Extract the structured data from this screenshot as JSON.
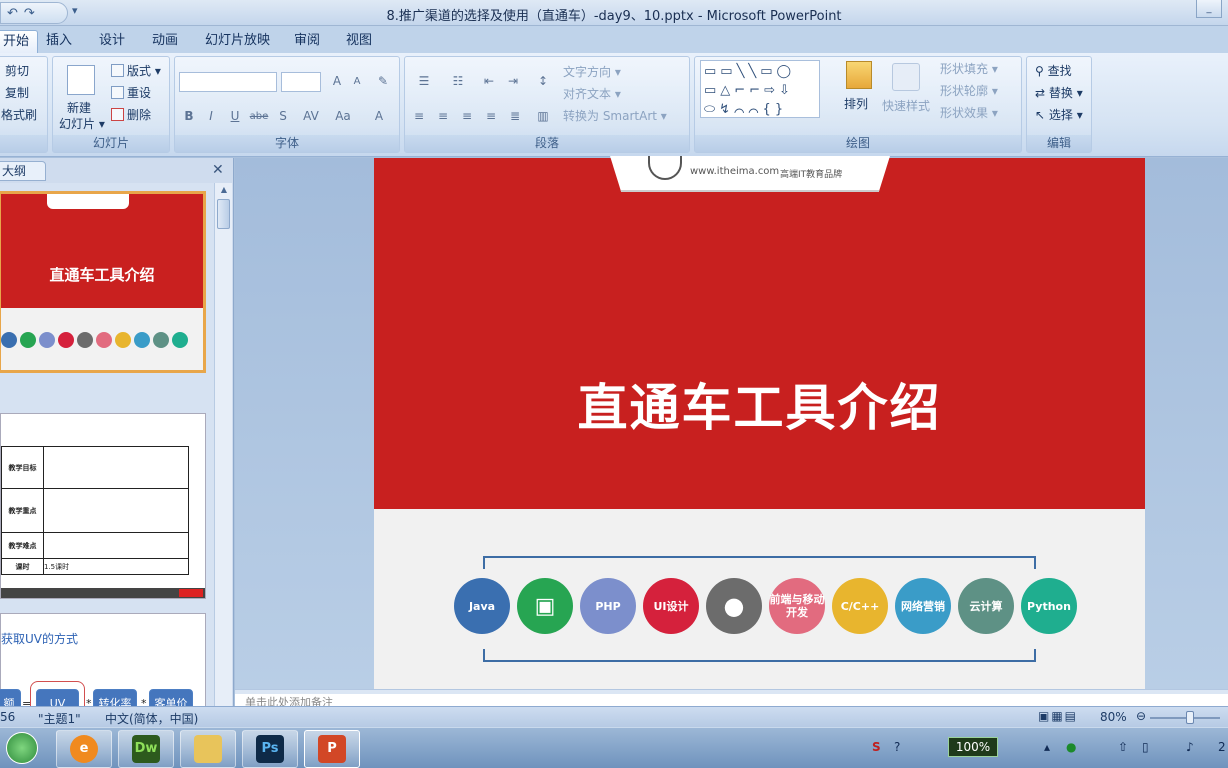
{
  "window": {
    "title": "8.推广渠道的选择及使用（直通车）-day9、10.pptx - Microsoft PowerPoint",
    "qat_more": "▾"
  },
  "tabs": [
    "开始",
    "插入",
    "设计",
    "动画",
    "幻灯片放映",
    "审阅",
    "视图"
  ],
  "ribbon": {
    "clipboard": {
      "cut": "剪切",
      "copy": "复制",
      "format_painter": "格式刷"
    },
    "slides": {
      "new_slide": "新建",
      "new_slide2": "幻灯片",
      "layout": "版式",
      "reset": "重设",
      "delete": "删除",
      "label": "幻灯片"
    },
    "font": {
      "label": "字体",
      "bold": "B",
      "italic": "I",
      "underline": "U",
      "strike": "abe",
      "shadow": "S",
      "spacing": "AV",
      "case": "Aa",
      "color": "A",
      "grow": "A",
      "shrink": "A"
    },
    "paragraph": {
      "label": "段落",
      "text_direction": "文字方向",
      "align_text": "对齐文本",
      "smartart": "转换为 SmartArt"
    },
    "drawing": {
      "label": "绘图",
      "arrange": "排列",
      "quick_styles": "快速样式",
      "fill": "形状填充",
      "outline": "形状轮廓",
      "effects": "形状效果"
    },
    "editing": {
      "label": "编辑",
      "find": "查找",
      "replace": "替换",
      "select": "选择"
    }
  },
  "left_panel": {
    "tab": "大纲",
    "close": "✕",
    "thumb1_title": "直通车工具介绍",
    "thumb2_rows": [
      {
        "head": "教学目标",
        "body": ""
      },
      {
        "head": "教学重点",
        "body": ""
      },
      {
        "head": "教学难点",
        "body": ""
      },
      {
        "head": "课时",
        "body": "1.5课时"
      }
    ],
    "thumb3_title": "获取UV的方式",
    "thumb3_boxes": {
      "sales": "额",
      "uv": "UV",
      "conv": "转化率",
      "aov": "客单价",
      "eq": "=",
      "mul1": "*",
      "mul2": "*"
    }
  },
  "slide": {
    "title": "直通车工具介绍",
    "logo_site": "www.itheima.com",
    "logo_slogan": "高端IT教育品牌",
    "tech": [
      {
        "name": "Java",
        "color": "#3a6fb0"
      },
      {
        "name": "Android",
        "color": "#27a552"
      },
      {
        "name": "PHP",
        "color": "#7c8fcc"
      },
      {
        "name": "UI设计",
        "color": "#d5213c"
      },
      {
        "name": "iOS",
        "color": "#6c6c6c"
      },
      {
        "name": "前端与移动开发",
        "color": "#e26b7f"
      },
      {
        "name": "C/C++",
        "color": "#e8b52e"
      },
      {
        "name": "网络营销",
        "color": "#3a9cc8"
      },
      {
        "name": "云计算",
        "color": "#5e9185"
      },
      {
        "name": "Python",
        "color": "#1fae8f"
      }
    ]
  },
  "notes_placeholder": "单击此处添加备注",
  "status": {
    "slide_num": "56",
    "theme": "\"主题1\"",
    "language": "中文(简体，中国)",
    "zoom": "80%"
  },
  "taskbar": {
    "battery": "100%",
    "clock_fragment": "2"
  }
}
